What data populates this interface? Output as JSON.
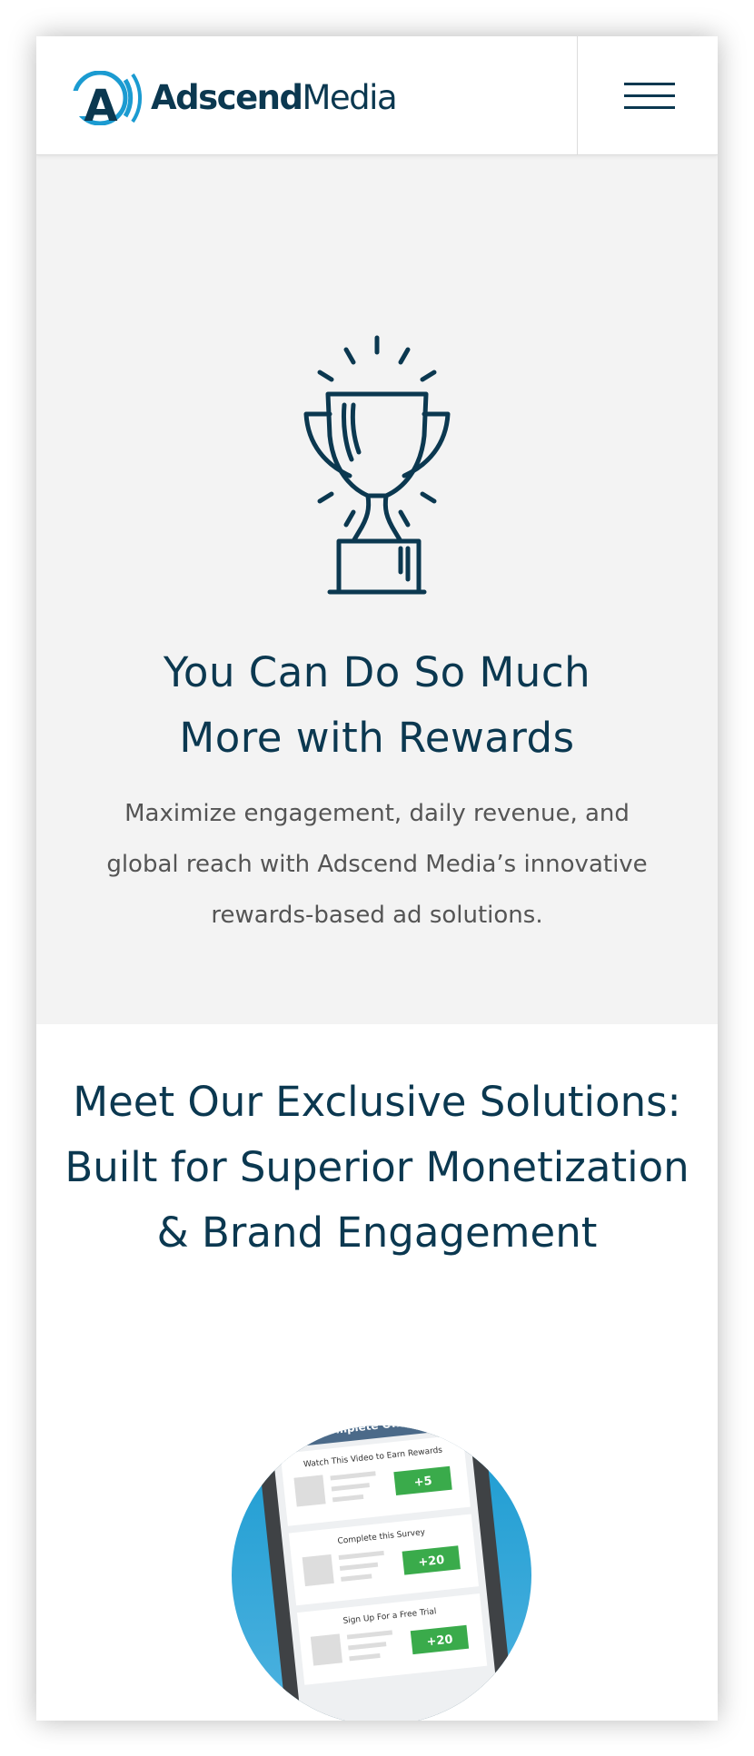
{
  "header": {
    "logo": {
      "name_bold": "Adscend",
      "name_regular": "Media",
      "mark_letter": "A"
    },
    "menu": {
      "icon": "hamburger-icon"
    }
  },
  "hero": {
    "icon": "trophy-icon",
    "title_line1": "You Can Do So Much",
    "title_line2": "More with Rewards",
    "text_line1": "Maximize engagement, daily revenue, and",
    "text_line2": "global reach with Adscend Media’s innovative",
    "text_line3": "rewards-based ad solutions."
  },
  "solutions": {
    "title_line1": "Meet Our Exclusive Solutions:",
    "title_line2": "Built for Superior Monetization",
    "title_line3": "& Brand Engagement"
  },
  "phone_mock": {
    "screen_title": "Complete Offers",
    "offers": [
      {
        "label": "Watch This Video to Earn Rewards",
        "reward": "+5"
      },
      {
        "label": "Complete this Survey",
        "reward": "+20"
      },
      {
        "label": "Sign Up For a Free Trial",
        "reward": "+20"
      }
    ]
  },
  "colors": {
    "navy": "#0b3850",
    "hero_bg": "#f3f3f3",
    "accent_blue": "#1b9bd1",
    "reward_green": "#3aab4b",
    "body_text": "#555555"
  }
}
